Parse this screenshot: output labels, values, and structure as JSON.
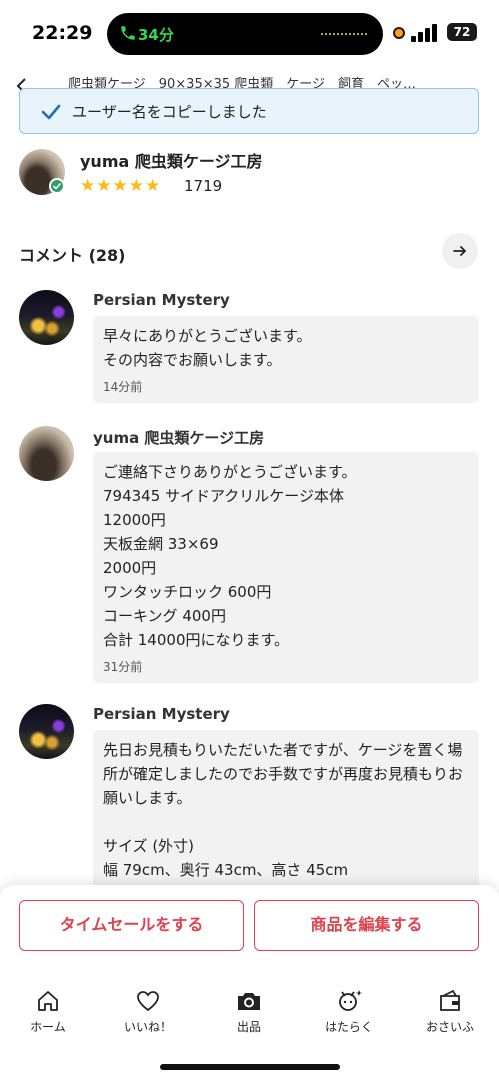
{
  "status_bar": {
    "time": "22:29",
    "call_duration": "34分",
    "battery": "72",
    "icons": [
      "phone-icon",
      "mic-indicator-icon",
      "signal-icon",
      "battery-icon"
    ]
  },
  "header": {
    "title": "爬虫類ケージ　90×35×35 爬虫類　ケージ　飼育　ペッ…",
    "back_icon": "chevron-left-icon"
  },
  "toast": {
    "message": "ユーザー名をコピーしました",
    "icon": "check-icon"
  },
  "seller": {
    "name": "yuma 爬虫類ケージ工房",
    "stars": "★★★★★",
    "rating": 5,
    "rating_count": "1719",
    "badge_icon": "verified-badge-icon"
  },
  "comments": {
    "title": "コメント (28)",
    "items": [
      {
        "author": "Persian Mystery",
        "text": "早々にありがとうございます。\nその内容でお願いします。",
        "time": "14分前"
      },
      {
        "author": "yuma 爬虫類ケージ工房",
        "text": "ご連絡下さりありがとうございます。\n794345 サイドアクリルケージ本体\n12000円\n天板金網 33×69\n2000円\nワンタッチロック 600円\nコーキング 400円\n合計 14000円になります。",
        "time": "31分前"
      },
      {
        "author": "Persian Mystery",
        "text": "先日お見積もりいただいた者ですが、ケージを置く場所が確定しましたのでお手数ですが再度お見積もりお願いします。\n\nサイズ (外寸)\n幅 79cm、奥行 43cm、高さ 45cm",
        "time": ""
      }
    ]
  },
  "actions": {
    "timesale_label": "タイムセールをする",
    "edit_label": "商品を編集する"
  },
  "tabs": [
    {
      "label": "ホーム",
      "icon": "home-icon"
    },
    {
      "label": "いいね！",
      "icon": "heart-icon"
    },
    {
      "label": "出品",
      "icon": "camera-icon"
    },
    {
      "label": "はたらく",
      "icon": "sparkle-clock-icon"
    },
    {
      "label": "おさいふ",
      "icon": "wallet-icon"
    }
  ],
  "colors": {
    "accent": "#e0424d",
    "star": "#ffb818",
    "toast_bg": "#e9f3fb",
    "toast_border": "#8fc5ea",
    "check": "#1f6fb8",
    "verified": "#2f9e6a"
  }
}
